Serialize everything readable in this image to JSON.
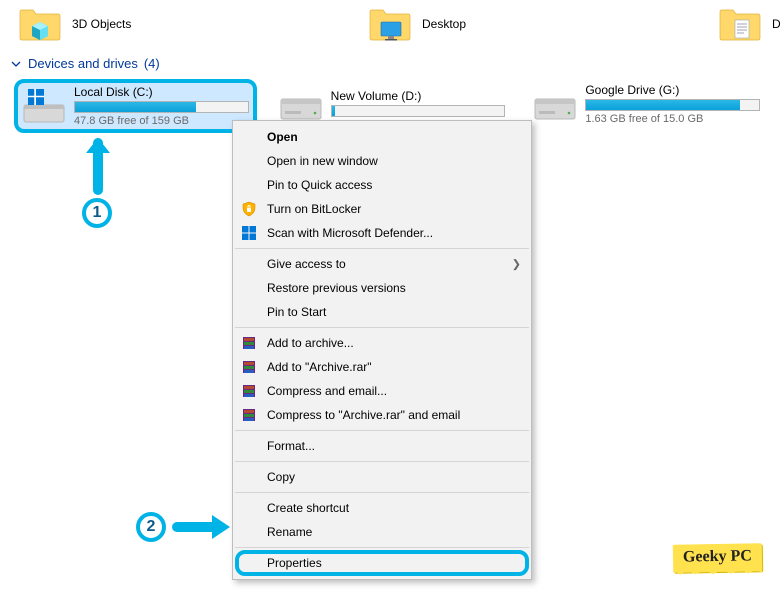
{
  "folders": [
    {
      "label": "3D Objects",
      "icon": "3d-objects"
    },
    {
      "label": "Desktop",
      "icon": "desktop"
    },
    {
      "label": "Documents",
      "icon": "documents"
    }
  ],
  "section": {
    "title": "Devices and drives",
    "count": "(4)"
  },
  "drives": [
    {
      "name": "Local Disk (C:)",
      "status": "47.8 GB free of 159 GB",
      "fill_pct": 70,
      "selected": true,
      "icon": "windows"
    },
    {
      "name": "New Volume (D:)",
      "status": "",
      "fill_pct": 2,
      "selected": false,
      "icon": "disk"
    },
    {
      "name": "Google Drive (G:)",
      "status": "1.63 GB free of 15.0 GB",
      "fill_pct": 89,
      "selected": false,
      "icon": "disk"
    }
  ],
  "context_menu": {
    "groups": [
      [
        {
          "label": "Open",
          "bold": true
        },
        {
          "label": "Open in new window"
        },
        {
          "label": "Pin to Quick access"
        },
        {
          "label": "Turn on BitLocker",
          "icon": "shield"
        },
        {
          "label": "Scan with Microsoft Defender...",
          "icon": "defender"
        }
      ],
      [
        {
          "label": "Give access to",
          "submenu": true
        },
        {
          "label": "Restore previous versions"
        },
        {
          "label": "Pin to Start"
        }
      ],
      [
        {
          "label": "Add to archive...",
          "icon": "rar"
        },
        {
          "label": "Add to \"Archive.rar\"",
          "icon": "rar"
        },
        {
          "label": "Compress and email...",
          "icon": "rar"
        },
        {
          "label": "Compress to \"Archive.rar\" and email",
          "icon": "rar"
        }
      ],
      [
        {
          "label": "Format..."
        }
      ],
      [
        {
          "label": "Copy"
        }
      ],
      [
        {
          "label": "Create shortcut"
        },
        {
          "label": "Rename"
        }
      ],
      [
        {
          "label": "Properties",
          "highlight": true
        }
      ]
    ]
  },
  "annotations": {
    "badge1": "1",
    "badge2": "2"
  },
  "watermark": "Geeky PC"
}
